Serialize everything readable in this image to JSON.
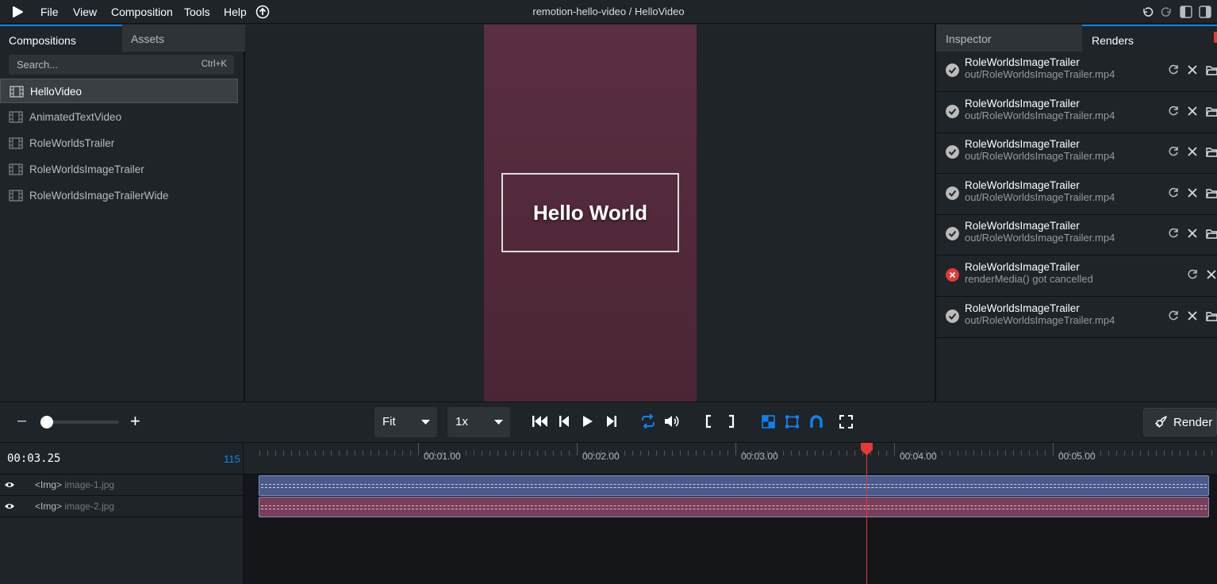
{
  "menubar": {
    "items": [
      "File",
      "View",
      "Composition",
      "Tools",
      "Help"
    ],
    "title": "remotion-hello-video / HelloVideo"
  },
  "left_panel": {
    "tabs": [
      "Compositions",
      "Assets"
    ],
    "search": {
      "placeholder": "Search...",
      "shortcut": "Ctrl+K"
    },
    "compositions": [
      "HelloVideo",
      "AnimatedTextVideo",
      "RoleWorldsTrailer",
      "RoleWorldsImageTrailer",
      "RoleWorldsImageTrailerWide"
    ],
    "selected": "HelloVideo"
  },
  "preview": {
    "text": "Hello World"
  },
  "right_panel": {
    "tabs": [
      "Inspector",
      "Renders"
    ],
    "renders": [
      {
        "name": "RoleWorldsImageTrailer",
        "detail": "out/RoleWorldsImageTrailer.mp4",
        "status": "done"
      },
      {
        "name": "RoleWorldsImageTrailer",
        "detail": "out/RoleWorldsImageTrailer.mp4",
        "status": "done"
      },
      {
        "name": "RoleWorldsImageTrailer",
        "detail": "out/RoleWorldsImageTrailer.mp4",
        "status": "done"
      },
      {
        "name": "RoleWorldsImageTrailer",
        "detail": "out/RoleWorldsImageTrailer.mp4",
        "status": "done"
      },
      {
        "name": "RoleWorldsImageTrailer",
        "detail": "out/RoleWorldsImageTrailer.mp4",
        "status": "done"
      },
      {
        "name": "RoleWorldsImageTrailer",
        "detail": "renderMedia() got cancelled",
        "status": "error"
      },
      {
        "name": "RoleWorldsImageTrailer",
        "detail": "out/RoleWorldsImageTrailer.mp4",
        "status": "done"
      }
    ]
  },
  "controls": {
    "zoom_minus": "–",
    "zoom_plus": "+",
    "size_select": "Fit",
    "speed_select": "1x",
    "render_label": "Render"
  },
  "timeline": {
    "timecode": "00:03.25",
    "frame": "115",
    "ruler_labels": [
      "00:01.00",
      "00:02.00",
      "00:03.00",
      "00:04.00",
      "00:05.00"
    ],
    "tracks": [
      {
        "tag": "<Img>",
        "src": "image-1.jpg",
        "color": "#4a5a8a"
      },
      {
        "tag": "<Img>",
        "src": "image-2.jpg",
        "color": "#7a3d5a"
      }
    ]
  },
  "colors": {
    "accent": "#0b84f3",
    "error": "#e53935",
    "playhead": "#e53935"
  }
}
